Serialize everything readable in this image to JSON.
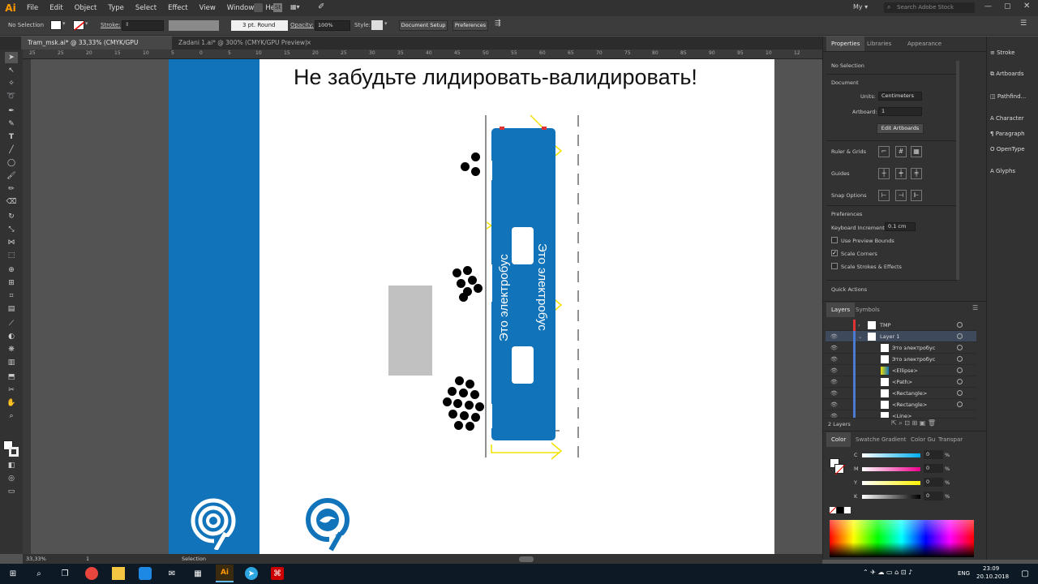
{
  "app": {
    "logo": "Ai"
  },
  "menu": [
    "File",
    "Edit",
    "Object",
    "Type",
    "Select",
    "Effect",
    "View",
    "Window",
    "Help"
  ],
  "menu_right": {
    "workspace": "My",
    "search_placeholder": "Search Adobe Stock"
  },
  "control": {
    "selection": "No Selection",
    "stroke_label": "Stroke:",
    "brush": "3 pt. Round",
    "opacity_label": "Opacity:",
    "opacity": "100%",
    "style_label": "Style:",
    "document_setup": "Document Setup",
    "preferences": "Preferences"
  },
  "tabs": [
    {
      "label": "Tram_msk.ai* @ 33,33% (CMYK/GPU Preview)",
      "close": "×"
    },
    {
      "label": "Zadani 1.ai* @ 300% (CMYK/GPU Preview)",
      "close": "×"
    }
  ],
  "ruler_ticks": [
    "25",
    "25",
    "20",
    "15",
    "10",
    "5",
    "0",
    "5",
    "10",
    "15",
    "20",
    "25",
    "30",
    "35",
    "40",
    "45",
    "50",
    "55",
    "60",
    "65",
    "70",
    "75",
    "80",
    "85",
    "90",
    "95",
    "10",
    "12"
  ],
  "artboard": {
    "headline": "Не забудьте лидировать-валидировать!",
    "bus_text_left": "Это электробус",
    "bus_text_right": "Это электробус",
    "colors": {
      "blue": "#1173ba",
      "yellow": "#f2e200",
      "gray": "#c1c1c1"
    }
  },
  "status": {
    "zoom": "33,33%",
    "artboard_num": "1",
    "tool": "Selection"
  },
  "properties": {
    "tabs": [
      "Properties",
      "Libraries",
      "Appearance"
    ],
    "no_selection": "No Selection",
    "document": "Document",
    "units_label": "Units:",
    "units": "Centimeters",
    "artboard_label": "Artboard:",
    "artboard_value": "1",
    "edit_artboards": "Edit Artboards",
    "ruler_grids": "Ruler & Grids",
    "guides": "Guides",
    "snap_options": "Snap Options",
    "preferences": "Preferences",
    "keyboard_increment_label": "Keyboard Increment:",
    "keyboard_increment": "0.1 cm",
    "use_preview_bounds": "Use Preview Bounds",
    "scale_corners": "Scale Corners",
    "scale_strokes": "Scale Strokes & Effects",
    "quick_actions": "Quick Actions",
    "scale_corners_checked": true
  },
  "layers": {
    "tabs": [
      "Layers",
      "Symbols"
    ],
    "rows": [
      {
        "name": "TMP",
        "indent": 0
      },
      {
        "name": "Layer 1",
        "indent": 0
      },
      {
        "name": "Это электробус",
        "indent": 1
      },
      {
        "name": "Это электробус",
        "indent": 1
      },
      {
        "name": "<Ellipse>",
        "indent": 1
      },
      {
        "name": "<Path>",
        "indent": 1
      },
      {
        "name": "<Rectangle>",
        "indent": 1
      },
      {
        "name": "<Rectangle>",
        "indent": 1
      },
      {
        "name": "<Line>",
        "indent": 1
      }
    ],
    "count": "2 Layers"
  },
  "color": {
    "tabs": [
      "Color",
      "Swatche",
      "Gradient",
      "Color Gu",
      "Transpar"
    ],
    "channels": [
      {
        "label": "C",
        "value": "0",
        "unit": "%"
      },
      {
        "label": "M",
        "value": "0",
        "unit": "%"
      },
      {
        "label": "Y",
        "value": "0",
        "unit": "%"
      },
      {
        "label": "K",
        "value": "0",
        "unit": "%"
      }
    ]
  },
  "side_panels": [
    "Stroke",
    "Artboards",
    "Pathfind...",
    "Character",
    "Paragraph",
    "OpenType",
    "Glyphs"
  ],
  "taskbar": {
    "lang": "ENG",
    "time": "23:09",
    "date": "20.10.2018"
  }
}
